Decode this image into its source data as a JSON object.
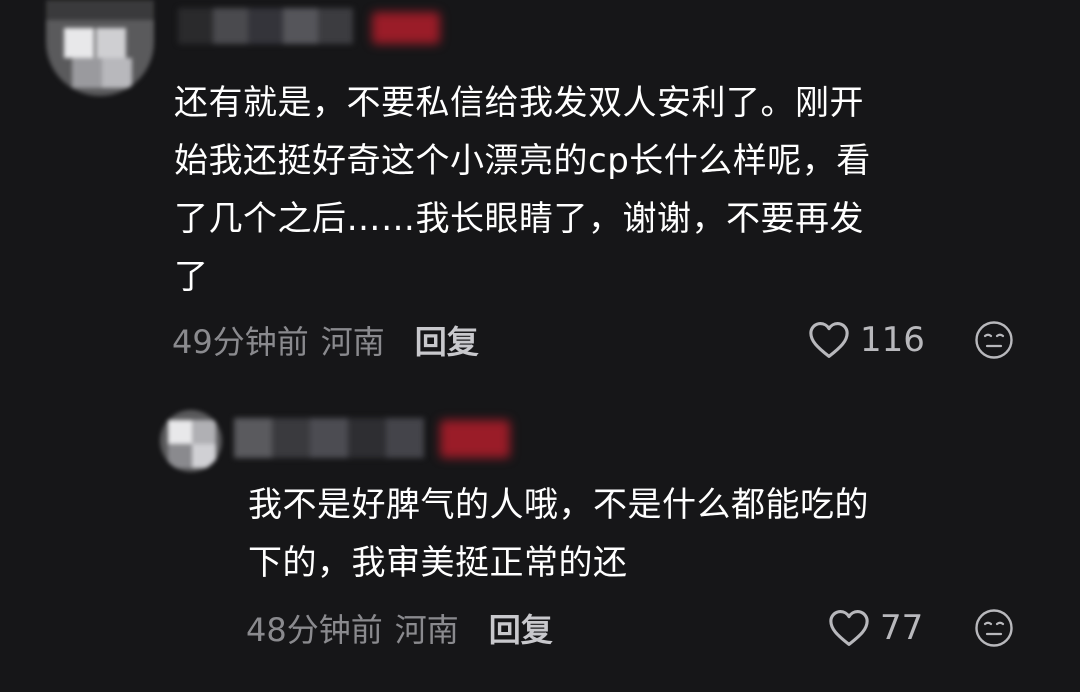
{
  "comments": [
    {
      "text_lines": [
        "还有就是，不要私信给我发双人安利了。刚开",
        "始我还挺好奇这个小漂亮的cp长什么样呢，看",
        "了几个之后……我长眼睛了，谢谢，不要再发",
        "了"
      ],
      "time": "49分钟前",
      "location": "河南",
      "reply_label": "回复",
      "likes": "116"
    },
    {
      "text_lines": [
        "我不是好脾气的人哦，不是什么都能吃的",
        "下的，我审美挺正常的还"
      ],
      "time": "48分钟前",
      "location": "河南",
      "reply_label": "回复",
      "likes": "77"
    }
  ],
  "colors": {
    "background": "#161618",
    "text": "#ffffff",
    "meta": "#8a8a8e",
    "badge": "#9a1c28"
  },
  "icons": [
    "heart-icon",
    "emoji-icon"
  ]
}
